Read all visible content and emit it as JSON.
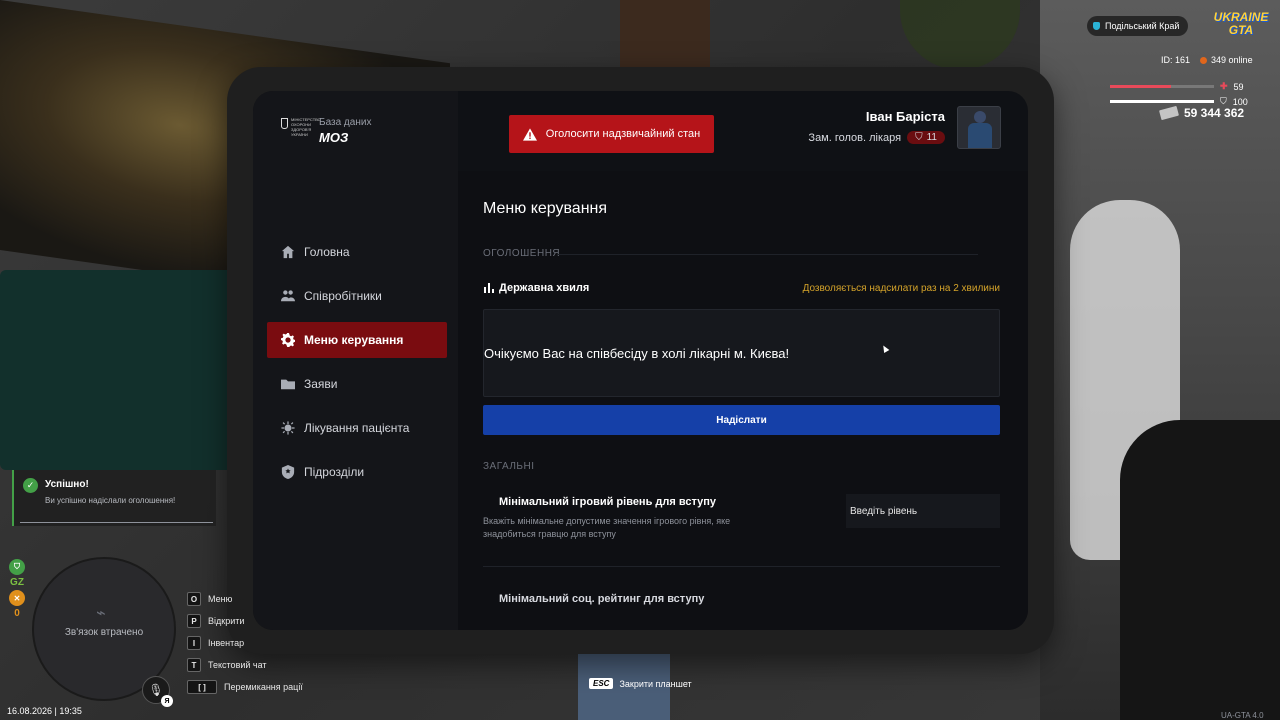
{
  "hud": {
    "server_name": "Подільський Край",
    "logo_line1": "UKRAINE",
    "logo_line2": "GTA",
    "player_id": "ID: 161",
    "online": "349 online",
    "health": "59",
    "armor": "100",
    "health_level": 0.59,
    "armor_level": 1.0,
    "money": "59 344 362",
    "health_color": "#e84a5a",
    "armor_color": "#ffffff"
  },
  "tablet": {
    "logo_small": "База даних",
    "logo_big": "МОЗ",
    "logo_emblem_text": "МІНІСТЕРСТВО ОХОРОНИ ЗДОРОВ'Я УКРАЇНИ",
    "emergency_button": "Оголосити надзвичайний стан",
    "user_name": "Іван Баріста",
    "user_role": "Зам. голов. лікаря",
    "user_rank": "11",
    "nav": [
      {
        "label": "Головна",
        "icon": "home-icon"
      },
      {
        "label": "Співробітники",
        "icon": "users-icon"
      },
      {
        "label": "Меню керування",
        "icon": "gear-icon"
      },
      {
        "label": "Заяви",
        "icon": "folder-icon"
      },
      {
        "label": "Лікування пацієнта",
        "icon": "virus-icon"
      },
      {
        "label": "Підрозділи",
        "icon": "shield-icon"
      }
    ],
    "active_nav": 2,
    "page_title": "Меню керування",
    "section_announcements": "ОГОЛОШЕННЯ",
    "wave_title": "Державна хвиля",
    "wave_note": "Дозволяється надсилати раз на 2 хвилини",
    "message_text": "Очікуємо Вас на співбесіду в холі лікарні м. Києва!",
    "send_button": "Надіслати",
    "section_general": "ЗАГАЛЬНІ",
    "setting1_title": "Мінімальний ігровий рівень для вступу",
    "setting1_desc": "Вкажіть мінімальне допустиме значення ігрового рівня, яке знадобиться гравцю для вступу",
    "setting1_placeholder": "Введіть рівень",
    "setting2_title": "Мінімальний соц. рейтинг для вступу",
    "accent_red": "#b51419",
    "accent_blue": "#1540a8",
    "accent_gold": "#d4a32a"
  },
  "notification": {
    "title": "Успішно!",
    "text": "Ви успішно надіслали оголошення!"
  },
  "minimap": {
    "status": "Зв'язок втрачено",
    "mic_badge": "Я"
  },
  "side_icons": {
    "gz": "GZ",
    "count": "0"
  },
  "keys": [
    {
      "key": "O",
      "label": "Меню"
    },
    {
      "key": "P",
      "label": "Відкрити"
    },
    {
      "key": "I",
      "label": "Інвентар"
    },
    {
      "key": "T",
      "label": "Текстовий чат"
    },
    {
      "key": "[ ]",
      "label": "Перемикання рації"
    }
  ],
  "datetime": "16.08.2026 | 19:35",
  "esc_key": "ESC",
  "esc_hint": "Закрити планшет",
  "version": "UA-GTA 4.0"
}
